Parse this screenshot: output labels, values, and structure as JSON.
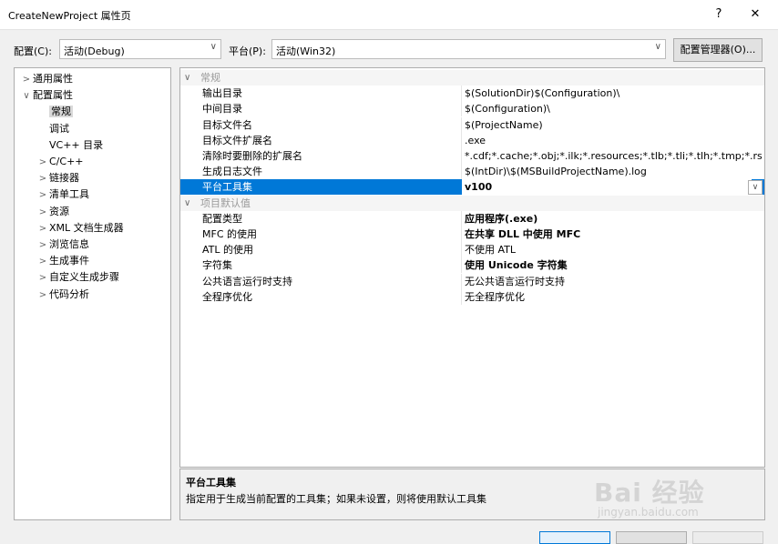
{
  "window": {
    "title": "CreateNewProject 属性页",
    "help_label": "?",
    "close_label": "✕"
  },
  "config_bar": {
    "config_label": "配置(C):",
    "config_value": "活动(Debug)",
    "platform_label": "平台(P):",
    "platform_value": "活动(Win32)",
    "manager_button": "配置管理器(O)..."
  },
  "tree": {
    "items": [
      {
        "label": "通用属性",
        "chevron": ">",
        "level": 0
      },
      {
        "label": "配置属性",
        "chevron": "∨",
        "level": 0
      },
      {
        "label": "常规",
        "chevron": "",
        "level": 1,
        "selected": true
      },
      {
        "label": "调试",
        "chevron": "",
        "level": 1
      },
      {
        "label": "VC++ 目录",
        "chevron": "",
        "level": 1
      },
      {
        "label": "C/C++",
        "chevron": ">",
        "level": 1
      },
      {
        "label": "链接器",
        "chevron": ">",
        "level": 1
      },
      {
        "label": "清单工具",
        "chevron": ">",
        "level": 1
      },
      {
        "label": "资源",
        "chevron": ">",
        "level": 1
      },
      {
        "label": "XML 文档生成器",
        "chevron": ">",
        "level": 1
      },
      {
        "label": "浏览信息",
        "chevron": ">",
        "level": 1
      },
      {
        "label": "生成事件",
        "chevron": ">",
        "level": 1
      },
      {
        "label": "自定义生成步骤",
        "chevron": ">",
        "level": 1
      },
      {
        "label": "代码分析",
        "chevron": ">",
        "level": 1
      }
    ]
  },
  "grid": {
    "sections": [
      {
        "title": "常规",
        "rows": [
          {
            "name": "输出目录",
            "value": "$(SolutionDir)$(Configuration)\\"
          },
          {
            "name": "中间目录",
            "value": "$(Configuration)\\"
          },
          {
            "name": "目标文件名",
            "value": "$(ProjectName)"
          },
          {
            "name": "目标文件扩展名",
            "value": ".exe"
          },
          {
            "name": "清除时要删除的扩展名",
            "value": "*.cdf;*.cache;*.obj;*.ilk;*.resources;*.tlb;*.tli;*.tlh;*.tmp;*.rsp;*.pgc"
          },
          {
            "name": "生成日志文件",
            "value": "$(IntDir)\\$(MSBuildProjectName).log"
          },
          {
            "name": "平台工具集",
            "value": "v100",
            "selected": true
          }
        ]
      },
      {
        "title": "项目默认值",
        "rows": [
          {
            "name": "配置类型",
            "value": "应用程序(.exe)",
            "bold": true
          },
          {
            "name": "MFC 的使用",
            "value": "在共享 DLL 中使用 MFC",
            "bold": true
          },
          {
            "name": "ATL 的使用",
            "value": "不使用 ATL"
          },
          {
            "name": "字符集",
            "value": "使用 Unicode 字符集",
            "bold": true
          },
          {
            "name": "公共语言运行时支持",
            "value": "无公共语言运行时支持"
          },
          {
            "name": "全程序优化",
            "value": "无全程序优化"
          }
        ]
      }
    ]
  },
  "description": {
    "title": "平台工具集",
    "text": "指定用于生成当前配置的工具集；如果未设置，则将使用默认工具集"
  },
  "watermark": {
    "text": "Bai 经验",
    "sub": "jingyan.baidu.com"
  }
}
